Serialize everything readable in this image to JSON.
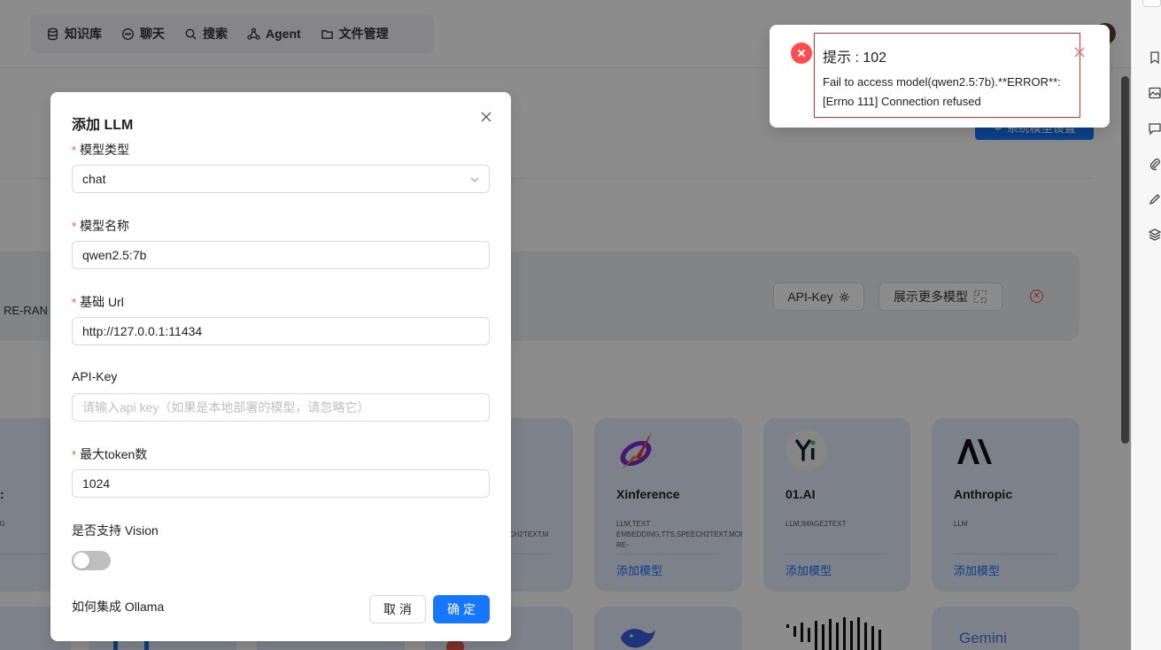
{
  "nav": {
    "items": [
      {
        "label": "知识库",
        "icon": "database-icon"
      },
      {
        "label": "聊天",
        "icon": "chat-icon"
      },
      {
        "label": "搜索",
        "icon": "search-icon"
      },
      {
        "label": "Agent",
        "icon": "agent-icon"
      },
      {
        "label": "文件管理",
        "icon": "folder-icon"
      }
    ]
  },
  "header": {
    "system_button_label": "系统模型设置"
  },
  "provider_bar": {
    "model_types_truncated": "RE-RAN",
    "api_key_button": "API-Key",
    "show_more_button": "展示更多模型"
  },
  "cards": {
    "left_partial": {
      "name": ":",
      "tags": "DDING"
    },
    "mid_partial": {
      "tags": "CH2TEXT,M"
    },
    "xinference": {
      "name": "Xinference",
      "tags": "LLM,TEXT EMBEDDING,TTS,SPEECH2TEXT,MODERATION,TEXT RE-",
      "add_label": "添加模型"
    },
    "zeroone": {
      "name": "01.AI",
      "tags": "LLM,IMAGE2TEXT",
      "add_label": "添加模型"
    },
    "anthropic": {
      "name": "Anthropic",
      "tags": "LLM",
      "add_label": "添加模型"
    },
    "gemini": {
      "logo_text": "Gemini"
    }
  },
  "modal": {
    "title": "添加 LLM",
    "required_mark": "*",
    "model_type_label": "模型类型",
    "model_type_value": "chat",
    "model_name_label": "模型名称",
    "model_name_value": "qwen2.5:7b",
    "base_url_label": "基础 Url",
    "base_url_value": "http://127.0.0.1:11434",
    "api_key_label": "API-Key",
    "api_key_placeholder": "请输入api key（如果是本地部署的模型，请忽略它）",
    "max_token_label": "最大token数",
    "max_token_value": "1024",
    "vision_label": "是否支持 Vision",
    "vision_enabled": false,
    "ollama_link": "如何集成 Ollama",
    "cancel_label": "取 消",
    "ok_label": "确 定"
  },
  "notification": {
    "title": "提示 : 102",
    "description": "Fail to access model(qwen2.5:7b).**ERROR**: [Errno 111] Connection refused",
    "status_color": "#ff4d4f"
  },
  "colors": {
    "primary": "#1677ff",
    "error": "#ff4d4f"
  }
}
